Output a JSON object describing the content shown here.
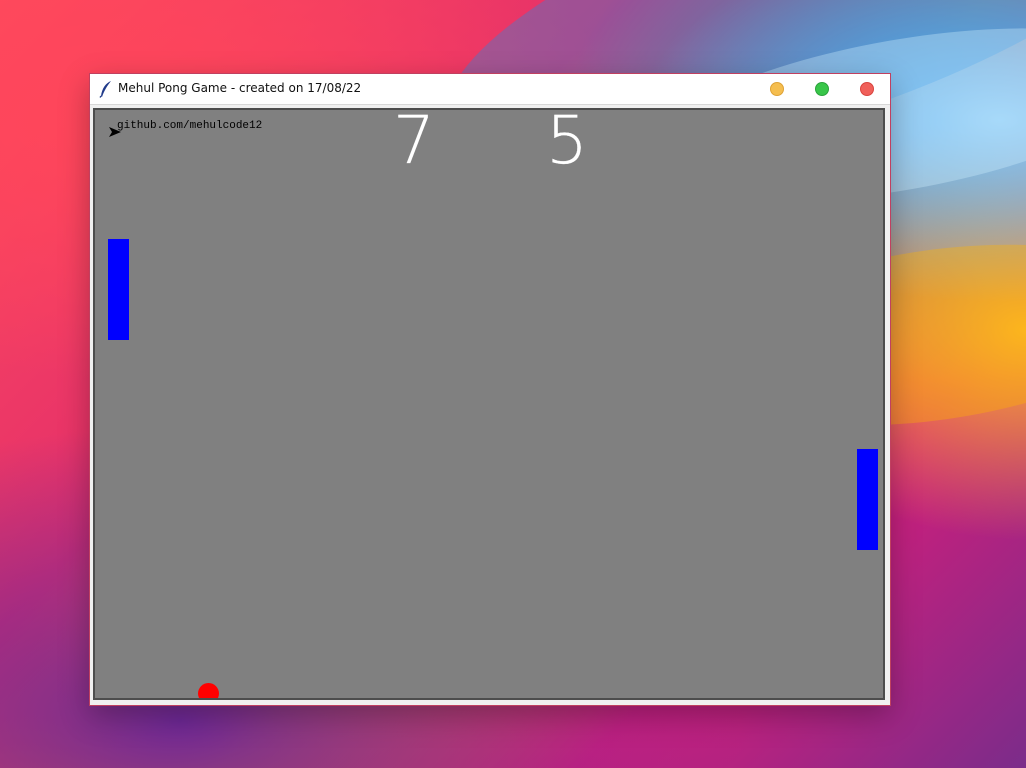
{
  "window": {
    "title": "Mehul Pong Game - created on 17/08/22",
    "icon": "feather-icon",
    "controls": [
      {
        "name": "minimize",
        "color": "#f5be4f"
      },
      {
        "name": "maximize",
        "color": "#38c649"
      },
      {
        "name": "close",
        "color": "#f0605a"
      }
    ]
  },
  "game": {
    "background_color": "#808080",
    "credit_text": "github.com/mehulcode12",
    "score_left": "7",
    "score_right": "5",
    "paddle_color": "#0000ff",
    "ball_color": "#ff0000",
    "cursor_icon": "turtle-arrow-icon"
  }
}
